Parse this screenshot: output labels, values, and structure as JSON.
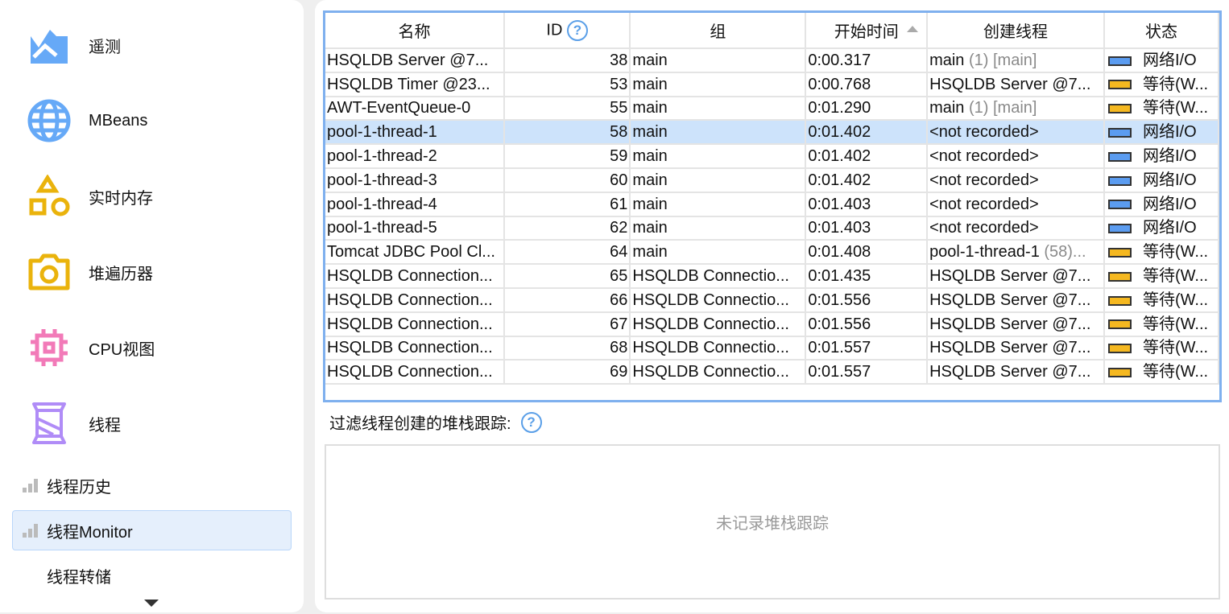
{
  "sidebar": {
    "items": [
      {
        "label": "遥测",
        "icon": "telemetry-icon"
      },
      {
        "label": "MBeans",
        "icon": "globe-icon"
      },
      {
        "label": "实时内存",
        "icon": "shapes-icon"
      },
      {
        "label": "堆遍历器",
        "icon": "camera-icon"
      },
      {
        "label": "CPU视图",
        "icon": "cpu-icon"
      },
      {
        "label": "线程",
        "icon": "spool-icon"
      }
    ],
    "subitems": [
      {
        "label": "线程历史"
      },
      {
        "label": "线程Monitor",
        "selected": true
      },
      {
        "label": "线程转储"
      }
    ]
  },
  "table": {
    "headers": {
      "name": "名称",
      "id": "ID",
      "group": "组",
      "start": "开始时间",
      "creator": "创建线程",
      "state": "状态"
    },
    "help": "?",
    "rows": [
      {
        "name": "HSQLDB Server @7...",
        "id": "38",
        "group": "main",
        "start": "0:00.317",
        "creator": "main",
        "creator_id": " (1) [main]",
        "state": "网络I/O",
        "color": "#5b9cf0"
      },
      {
        "name": "HSQLDB Timer @23...",
        "id": "53",
        "group": "main",
        "start": "0:00.768",
        "creator": "HSQLDB Server @7...",
        "creator_id": "",
        "state": "等待(W...",
        "color": "#f5b820"
      },
      {
        "name": "AWT-EventQueue-0",
        "id": "55",
        "group": "main",
        "start": "0:01.290",
        "creator": "main",
        "creator_id": " (1) [main]",
        "state": "等待(W...",
        "color": "#f5b820"
      },
      {
        "name": "pool-1-thread-1",
        "id": "58",
        "group": "main",
        "start": "0:01.402",
        "creator": "<not recorded>",
        "creator_id": "",
        "state": "网络I/O",
        "color": "#5b9cf0",
        "selected": true
      },
      {
        "name": "pool-1-thread-2",
        "id": "59",
        "group": "main",
        "start": "0:01.402",
        "creator": "<not recorded>",
        "creator_id": "",
        "state": "网络I/O",
        "color": "#5b9cf0"
      },
      {
        "name": "pool-1-thread-3",
        "id": "60",
        "group": "main",
        "start": "0:01.402",
        "creator": "<not recorded>",
        "creator_id": "",
        "state": "网络I/O",
        "color": "#5b9cf0"
      },
      {
        "name": "pool-1-thread-4",
        "id": "61",
        "group": "main",
        "start": "0:01.403",
        "creator": "<not recorded>",
        "creator_id": "",
        "state": "网络I/O",
        "color": "#5b9cf0"
      },
      {
        "name": "pool-1-thread-5",
        "id": "62",
        "group": "main",
        "start": "0:01.403",
        "creator": "<not recorded>",
        "creator_id": "",
        "state": "网络I/O",
        "color": "#5b9cf0"
      },
      {
        "name": "Tomcat JDBC Pool Cl...",
        "id": "64",
        "group": "main",
        "start": "0:01.408",
        "creator": "pool-1-thread-1",
        "creator_id": " (58)...",
        "state": "等待(W...",
        "color": "#f5b820"
      },
      {
        "name": "HSQLDB Connection...",
        "id": "65",
        "group": "HSQLDB Connectio...",
        "start": "0:01.435",
        "creator": "HSQLDB Server @7...",
        "creator_id": "",
        "state": "等待(W...",
        "color": "#f5b820"
      },
      {
        "name": "HSQLDB Connection...",
        "id": "66",
        "group": "HSQLDB Connectio...",
        "start": "0:01.556",
        "creator": "HSQLDB Server @7...",
        "creator_id": "",
        "state": "等待(W...",
        "color": "#f5b820"
      },
      {
        "name": "HSQLDB Connection...",
        "id": "67",
        "group": "HSQLDB Connectio...",
        "start": "0:01.556",
        "creator": "HSQLDB Server @7...",
        "creator_id": "",
        "state": "等待(W...",
        "color": "#f5b820"
      },
      {
        "name": "HSQLDB Connection...",
        "id": "68",
        "group": "HSQLDB Connectio...",
        "start": "0:01.557",
        "creator": "HSQLDB Server @7...",
        "creator_id": "",
        "state": "等待(W...",
        "color": "#f5b820"
      },
      {
        "name": "HSQLDB Connection...",
        "id": "69",
        "group": "HSQLDB Connectio...",
        "start": "0:01.557",
        "creator": "HSQLDB Server @7...",
        "creator_id": "",
        "state": "等待(W...",
        "color": "#f5b820"
      }
    ]
  },
  "filter": {
    "label": "过滤线程创建的堆栈跟踪:",
    "help": "?"
  },
  "stack": {
    "empty": "未记录堆栈跟踪"
  }
}
